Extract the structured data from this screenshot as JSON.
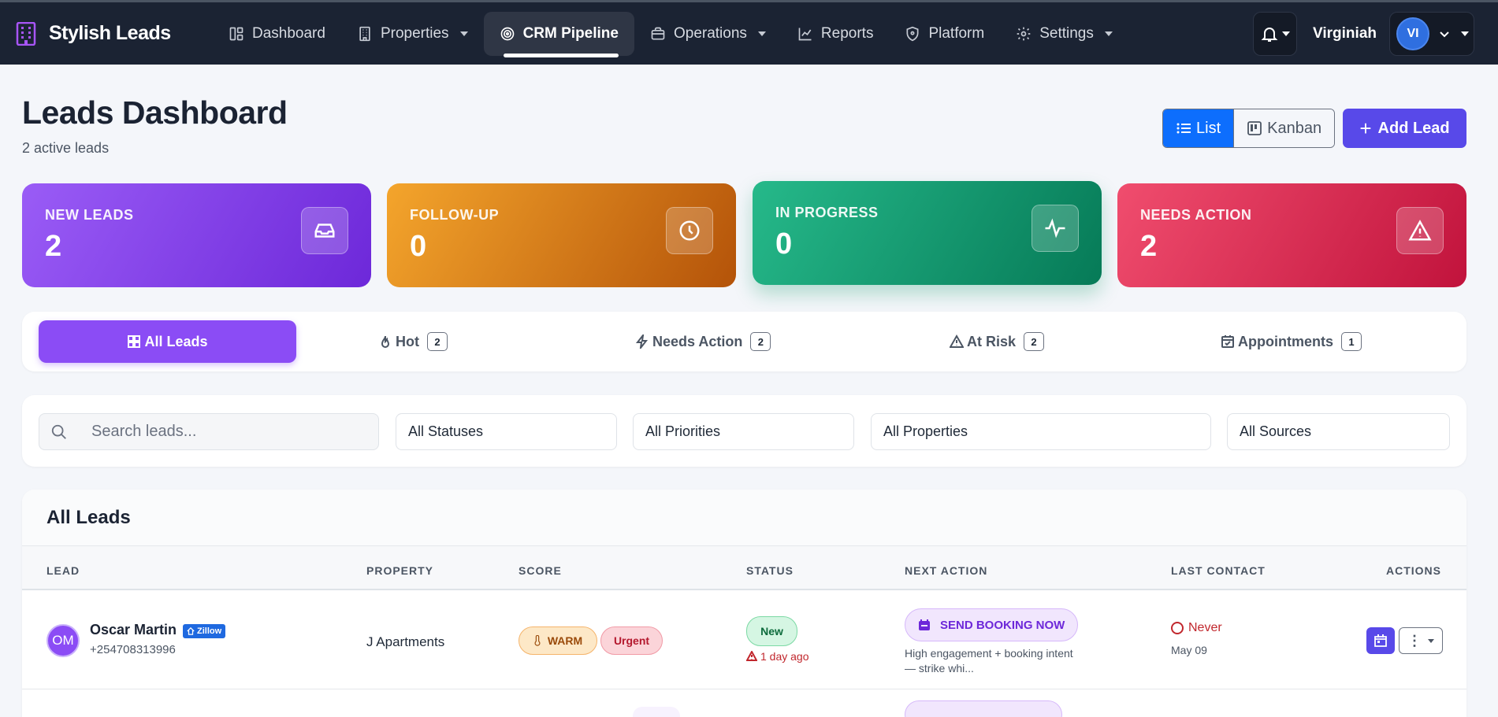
{
  "nav": {
    "brand": "Stylish Leads",
    "items": [
      {
        "label": "Dashboard",
        "icon": "dashboard-icon"
      },
      {
        "label": "Properties",
        "icon": "building-icon"
      },
      {
        "label": "CRM Pipeline",
        "icon": "target-icon"
      },
      {
        "label": "Operations",
        "icon": "briefcase-icon"
      },
      {
        "label": "Reports",
        "icon": "chart-icon"
      },
      {
        "label": "Platform",
        "icon": "shield-icon"
      },
      {
        "label": "Settings",
        "icon": "gear-icon"
      }
    ],
    "active": "CRM Pipeline",
    "user_name": "Virginiah",
    "user_initials": "VI"
  },
  "header": {
    "title": "Leads Dashboard",
    "subtitle": "2 active leads",
    "view_list": "List",
    "view_kanban": "Kanban",
    "add_lead": "Add Lead"
  },
  "stats": [
    {
      "label": "NEW LEADS",
      "value": "2",
      "icon": "inbox-icon",
      "color": "#7c3aed"
    },
    {
      "label": "FOLLOW-UP",
      "value": "0",
      "icon": "clock-icon",
      "color": "#d97706"
    },
    {
      "label": "IN PROGRESS",
      "value": "0",
      "icon": "activity-icon",
      "color": "#059669"
    },
    {
      "label": "NEEDS ACTION",
      "value": "2",
      "icon": "warning-icon",
      "color": "#e11d48"
    }
  ],
  "tabs": [
    {
      "label": "All Leads",
      "count": ""
    },
    {
      "label": "Hot",
      "count": "2"
    },
    {
      "label": "Needs Action",
      "count": "2"
    },
    {
      "label": "At Risk",
      "count": "2"
    },
    {
      "label": "Appointments",
      "count": "1"
    }
  ],
  "filters": {
    "search_placeholder": "Search leads...",
    "status": "All Statuses",
    "priority": "All Priorities",
    "property": "All Properties",
    "source": "All Sources"
  },
  "table": {
    "title": "All Leads",
    "columns": [
      "LEAD",
      "PROPERTY",
      "SCORE",
      "STATUS",
      "NEXT ACTION",
      "LAST CONTACT",
      "ACTIONS"
    ],
    "rows": [
      {
        "initials": "OM",
        "name": "Oscar Martin",
        "source": "Zillow",
        "phone": "+254708313996",
        "property": "J Apartments",
        "score": "WARM",
        "priority": "Urgent",
        "status": "New",
        "status_sub": "1 day ago",
        "next_action": "SEND BOOKING NOW",
        "next_action_desc": "High engagement + booking intent — strike whi...",
        "last_contact": "Never",
        "last_contact_date": "May 09"
      }
    ]
  },
  "colors": {
    "accent": "#8b4cf5",
    "primary": "#0d6efd",
    "add_lead": "#5849e9",
    "nav_bg": "#1b2333"
  }
}
